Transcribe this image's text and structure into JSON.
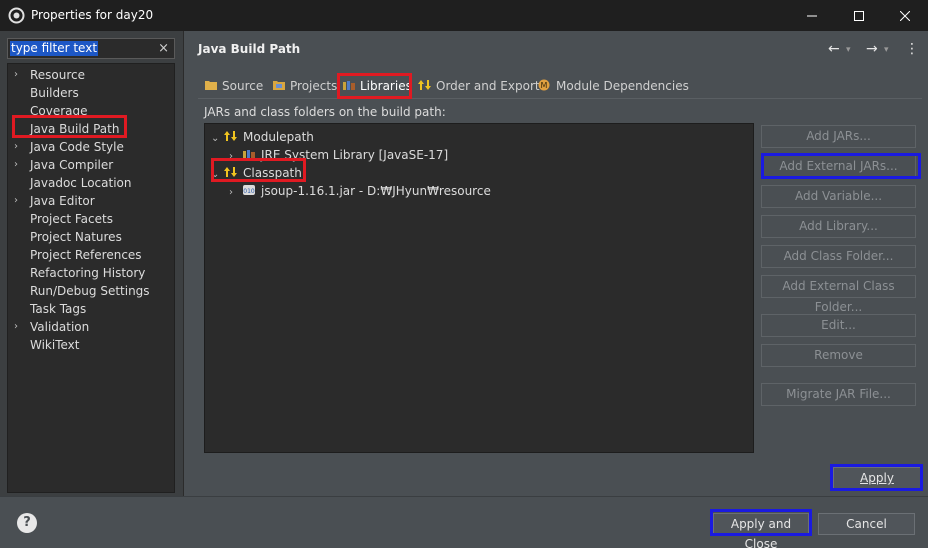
{
  "window": {
    "title": "Properties for day20",
    "minimize_icon": "minimize-icon",
    "maximize_icon": "maximize-icon",
    "close_icon": "close-icon"
  },
  "sidebar": {
    "filter_text": "type filter text",
    "clear_icon": "×",
    "items": [
      {
        "label": "Resource",
        "expandable": true
      },
      {
        "label": "Builders",
        "expandable": false
      },
      {
        "label": "Coverage",
        "expandable": false
      },
      {
        "label": "Java Build Path",
        "expandable": false,
        "selected": true
      },
      {
        "label": "Java Code Style",
        "expandable": true
      },
      {
        "label": "Java Compiler",
        "expandable": true
      },
      {
        "label": "Javadoc Location",
        "expandable": false
      },
      {
        "label": "Java Editor",
        "expandable": true
      },
      {
        "label": "Project Facets",
        "expandable": false
      },
      {
        "label": "Project Natures",
        "expandable": false
      },
      {
        "label": "Project References",
        "expandable": false
      },
      {
        "label": "Refactoring History",
        "expandable": false
      },
      {
        "label": "Run/Debug Settings",
        "expandable": false
      },
      {
        "label": "Task Tags",
        "expandable": false
      },
      {
        "label": "Validation",
        "expandable": true
      },
      {
        "label": "WikiText",
        "expandable": false
      }
    ]
  },
  "page": {
    "title": "Java Build Path",
    "back_icon": "←",
    "forward_icon": "→",
    "menu_icon": "⋮"
  },
  "tabs": [
    {
      "label": "Source",
      "icon": "source-folder-icon"
    },
    {
      "label": "Projects",
      "icon": "projects-icon"
    },
    {
      "label": "Libraries",
      "icon": "libraries-icon",
      "active": true
    },
    {
      "label": "Order and Export",
      "icon": "order-export-icon"
    },
    {
      "label": "Module Dependencies",
      "icon": "module-dependencies-icon"
    }
  ],
  "build_path": {
    "label": "JARs and class folders on the build path:",
    "tree": {
      "modulepath": "Modulepath",
      "jre": "JRE System Library [JavaSE-17]",
      "classpath": "Classpath",
      "jar": "jsoup-1.16.1.jar - D:₩JHyun₩resource"
    }
  },
  "buttons": {
    "add_jars": "Add JARs...",
    "add_external_jars": "Add External JARs...",
    "add_variable": "Add Variable...",
    "add_library": "Add Library...",
    "add_class_folder": "Add Class Folder...",
    "add_external_class_folder": "Add External Class Folder...",
    "edit": "Edit...",
    "remove": "Remove",
    "migrate_jar": "Migrate JAR File...",
    "apply": "Apply",
    "apply_and_close": "Apply and Close",
    "cancel": "Cancel",
    "help": "?"
  },
  "colors": {
    "highlight_red": "#e01a22",
    "highlight_blue": "#1a1ae0",
    "selection": "#1d57c5"
  }
}
